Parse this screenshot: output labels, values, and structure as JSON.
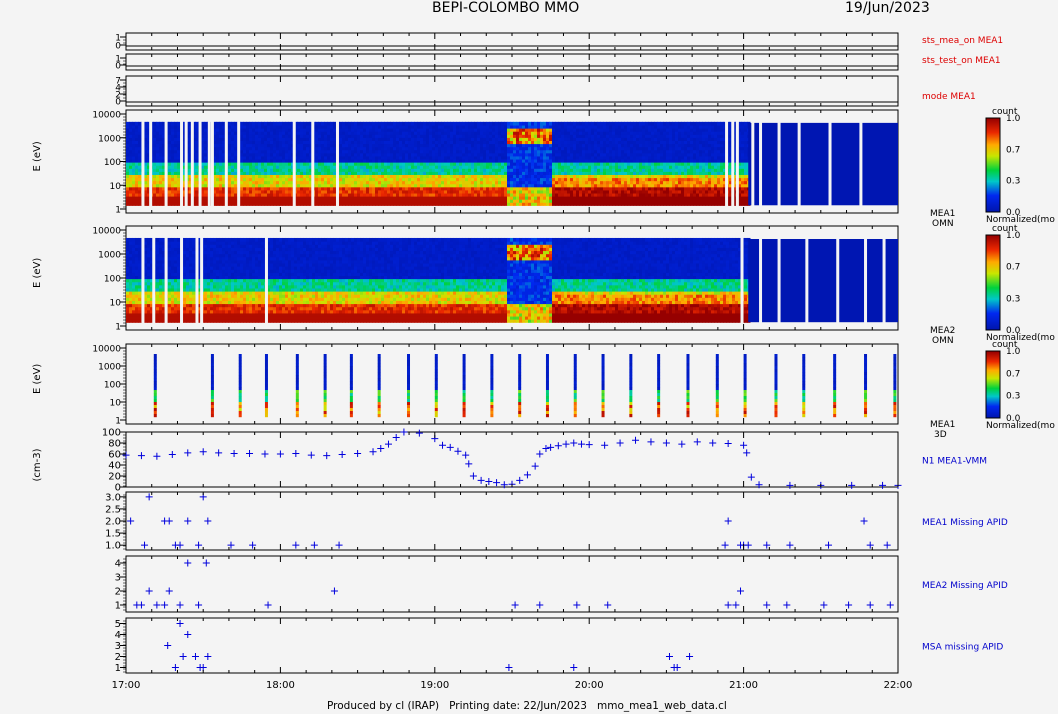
{
  "header": {
    "title": "BEPI-COLOMBO MMO",
    "date": "19/Jun/2023"
  },
  "footer": {
    "text": "Produced by cl (IRAP)   Printing date: 22/Jun/2023   mmo_mea1_web_data.cl"
  },
  "colors": {
    "background": "#f4f4f4",
    "label_red": "#dd0000",
    "label_blue": "#0000cc",
    "marker_blue": "#0000dd"
  },
  "time_axis": {
    "start_hours": 17,
    "end_hours": 22,
    "tick_labels": [
      "17:00",
      "18:00",
      "19:00",
      "20:00",
      "21:00",
      "22:00"
    ]
  },
  "chart_data": [
    {
      "type": "line",
      "name": "sts_mea_on",
      "label": "sts_mea_on MEA1",
      "yticks": [
        "1",
        "0"
      ]
    },
    {
      "type": "line",
      "name": "sts_test_on",
      "label": "sts_test_on MEA1",
      "yticks": [
        "1",
        "0"
      ]
    },
    {
      "type": "line",
      "name": "mode",
      "label": "mode MEA1",
      "yticks": [
        "7",
        "4",
        "2",
        "0"
      ]
    },
    {
      "type": "heatmap",
      "name": "MEA1 OMN",
      "label": [
        "MEA1",
        "OMN"
      ],
      "ylabel": "E (eV)",
      "yscale": "log",
      "yticks": [
        "10000",
        "1000",
        "100",
        "10",
        "1"
      ],
      "colorbar": {
        "title": "count",
        "ticks": [
          "1.0",
          "0.7",
          "0.3",
          "0.0"
        ],
        "label": "Normalized(mo"
      },
      "data_gaps_hours": [
        17.1,
        17.15,
        17.25,
        17.35,
        17.38,
        17.42,
        17.47,
        17.53,
        17.55,
        17.64,
        17.72,
        18.08,
        18.2,
        18.36,
        20.88,
        20.92,
        20.95,
        21.05,
        21.1,
        21.22,
        21.35,
        21.55,
        21.75
      ],
      "data_end_hours": 21.03,
      "features": [
        {
          "start": 19.48,
          "end": 19.72,
          "description": "high-energy enhancement up to ~3000 eV"
        }
      ]
    },
    {
      "type": "heatmap",
      "name": "MEA2 OMN",
      "label": [
        "MEA2",
        "OMN"
      ],
      "ylabel": "E (eV)",
      "yscale": "log",
      "yticks": [
        "10000",
        "1000",
        "100",
        "10",
        "1"
      ],
      "colorbar": {
        "title": "count",
        "ticks": [
          "1.0",
          "0.7",
          "0.3",
          "0.0"
        ],
        "label": "Normalized(mo"
      },
      "data_gaps_hours": [
        17.1,
        17.17,
        17.25,
        17.35,
        17.45,
        17.48,
        17.9,
        20.98,
        21.1,
        21.22,
        21.4,
        21.6,
        21.78,
        21.9
      ],
      "data_end_hours": 21.03
    },
    {
      "type": "heatmap",
      "name": "MEA1 3D",
      "label": [
        "MEA1",
        "3D"
      ],
      "ylabel": "E (eV)",
      "yscale": "log",
      "yticks": [
        "10000",
        "1000",
        "100",
        "10",
        "1"
      ],
      "colorbar": {
        "title": "count",
        "ticks": [
          "1.0",
          "0.7",
          "0.3",
          "0.0"
        ],
        "label": "Normalized(mo"
      },
      "sample_times_hours": [
        17.18,
        17.55,
        17.73,
        17.9,
        18.1,
        18.28,
        18.45,
        18.63,
        18.82,
        19.0,
        19.18,
        19.36,
        19.54,
        19.72,
        19.9,
        20.08,
        20.26,
        20.44,
        20.63,
        20.82,
        21.0,
        21.2,
        21.38,
        21.58,
        21.78,
        21.97
      ]
    },
    {
      "type": "scatter",
      "name": "N1 MEA1-VMM",
      "label": "N1 MEA1-VMM",
      "ylabel": "(cm-3)",
      "ylim": [
        0,
        100
      ],
      "yticks": [
        "100",
        "80",
        "60",
        "40",
        "20",
        "0"
      ],
      "points": [
        [
          17.0,
          58
        ],
        [
          17.1,
          57
        ],
        [
          17.2,
          56
        ],
        [
          17.3,
          59
        ],
        [
          17.4,
          62
        ],
        [
          17.5,
          64
        ],
        [
          17.6,
          62
        ],
        [
          17.7,
          61
        ],
        [
          17.8,
          61
        ],
        [
          17.9,
          60
        ],
        [
          18.0,
          60
        ],
        [
          18.1,
          61
        ],
        [
          18.2,
          58
        ],
        [
          18.3,
          57
        ],
        [
          18.4,
          59
        ],
        [
          18.5,
          61
        ],
        [
          18.6,
          64
        ],
        [
          18.65,
          70
        ],
        [
          18.7,
          78
        ],
        [
          18.75,
          90
        ],
        [
          18.8,
          100
        ],
        [
          18.9,
          98
        ],
        [
          19.0,
          88
        ],
        [
          19.05,
          76
        ],
        [
          19.1,
          72
        ],
        [
          19.15,
          65
        ],
        [
          19.2,
          58
        ],
        [
          19.22,
          42
        ],
        [
          19.25,
          20
        ],
        [
          19.3,
          12
        ],
        [
          19.35,
          10
        ],
        [
          19.4,
          8
        ],
        [
          19.45,
          4
        ],
        [
          19.5,
          5
        ],
        [
          19.55,
          12
        ],
        [
          19.6,
          22
        ],
        [
          19.65,
          38
        ],
        [
          19.68,
          60
        ],
        [
          19.72,
          70
        ],
        [
          19.75,
          72
        ],
        [
          19.8,
          75
        ],
        [
          19.85,
          78
        ],
        [
          19.9,
          80
        ],
        [
          19.95,
          78
        ],
        [
          20.0,
          77
        ],
        [
          20.1,
          76
        ],
        [
          20.2,
          80
        ],
        [
          20.3,
          85
        ],
        [
          20.4,
          82
        ],
        [
          20.5,
          80
        ],
        [
          20.6,
          78
        ],
        [
          20.7,
          82
        ],
        [
          20.8,
          80
        ],
        [
          20.9,
          79
        ],
        [
          21.0,
          76
        ],
        [
          21.02,
          62
        ],
        [
          21.05,
          18
        ],
        [
          21.1,
          4
        ],
        [
          21.3,
          3
        ],
        [
          21.5,
          3
        ],
        [
          21.7,
          3
        ],
        [
          21.9,
          3
        ],
        [
          22.0,
          3
        ]
      ]
    },
    {
      "type": "scatter",
      "name": "MEA1 Missing APID",
      "label": "MEA1 Missing APID",
      "ylim": [
        0.8,
        3.2
      ],
      "yticks": [
        "3.0",
        "2.5",
        "2.0",
        "1.5",
        "1.0"
      ],
      "points": [
        [
          17.03,
          2
        ],
        [
          17.12,
          1
        ],
        [
          17.15,
          3
        ],
        [
          17.25,
          2
        ],
        [
          17.28,
          2
        ],
        [
          17.32,
          1
        ],
        [
          17.35,
          1
        ],
        [
          17.4,
          2
        ],
        [
          17.47,
          1
        ],
        [
          17.5,
          3
        ],
        [
          17.53,
          2
        ],
        [
          17.68,
          1
        ],
        [
          17.82,
          1
        ],
        [
          18.1,
          1
        ],
        [
          18.22,
          1
        ],
        [
          18.38,
          1
        ],
        [
          20.88,
          1
        ],
        [
          20.9,
          2
        ],
        [
          20.98,
          1
        ],
        [
          21.0,
          1
        ],
        [
          21.03,
          1
        ],
        [
          21.15,
          1
        ],
        [
          21.3,
          1
        ],
        [
          21.55,
          1
        ],
        [
          21.78,
          2
        ],
        [
          21.82,
          1
        ],
        [
          21.93,
          1
        ]
      ]
    },
    {
      "type": "scatter",
      "name": "MEA2 Missing APID",
      "label": "MEA2 Missing APID",
      "ylim": [
        0.5,
        4.5
      ],
      "yticks": [
        "4",
        "3",
        "2",
        "1"
      ],
      "points": [
        [
          17.07,
          1
        ],
        [
          17.1,
          1
        ],
        [
          17.15,
          2
        ],
        [
          17.2,
          1
        ],
        [
          17.25,
          1
        ],
        [
          17.28,
          2
        ],
        [
          17.35,
          1
        ],
        [
          17.4,
          4
        ],
        [
          17.47,
          1
        ],
        [
          17.52,
          4
        ],
        [
          17.92,
          1
        ],
        [
          18.35,
          2
        ],
        [
          19.52,
          1
        ],
        [
          19.68,
          1
        ],
        [
          19.92,
          1
        ],
        [
          20.12,
          1
        ],
        [
          20.9,
          1
        ],
        [
          20.95,
          1
        ],
        [
          20.98,
          2
        ],
        [
          21.15,
          1
        ],
        [
          21.28,
          1
        ],
        [
          21.52,
          1
        ],
        [
          21.68,
          1
        ],
        [
          21.82,
          1
        ],
        [
          21.95,
          1
        ]
      ]
    },
    {
      "type": "scatter",
      "name": "MSA missing APID",
      "label": "MSA missing APID",
      "ylim": [
        0.5,
        5.5
      ],
      "yticks": [
        "5",
        "4",
        "3",
        "2",
        "1"
      ],
      "points": [
        [
          17.27,
          3
        ],
        [
          17.32,
          1
        ],
        [
          17.35,
          5
        ],
        [
          17.37,
          2
        ],
        [
          17.4,
          4
        ],
        [
          17.45,
          2
        ],
        [
          17.48,
          1
        ],
        [
          17.5,
          1
        ],
        [
          17.53,
          2
        ],
        [
          19.48,
          1
        ],
        [
          19.9,
          1
        ],
        [
          20.52,
          2
        ],
        [
          20.55,
          1
        ],
        [
          20.57,
          1
        ],
        [
          20.65,
          2
        ]
      ]
    }
  ]
}
